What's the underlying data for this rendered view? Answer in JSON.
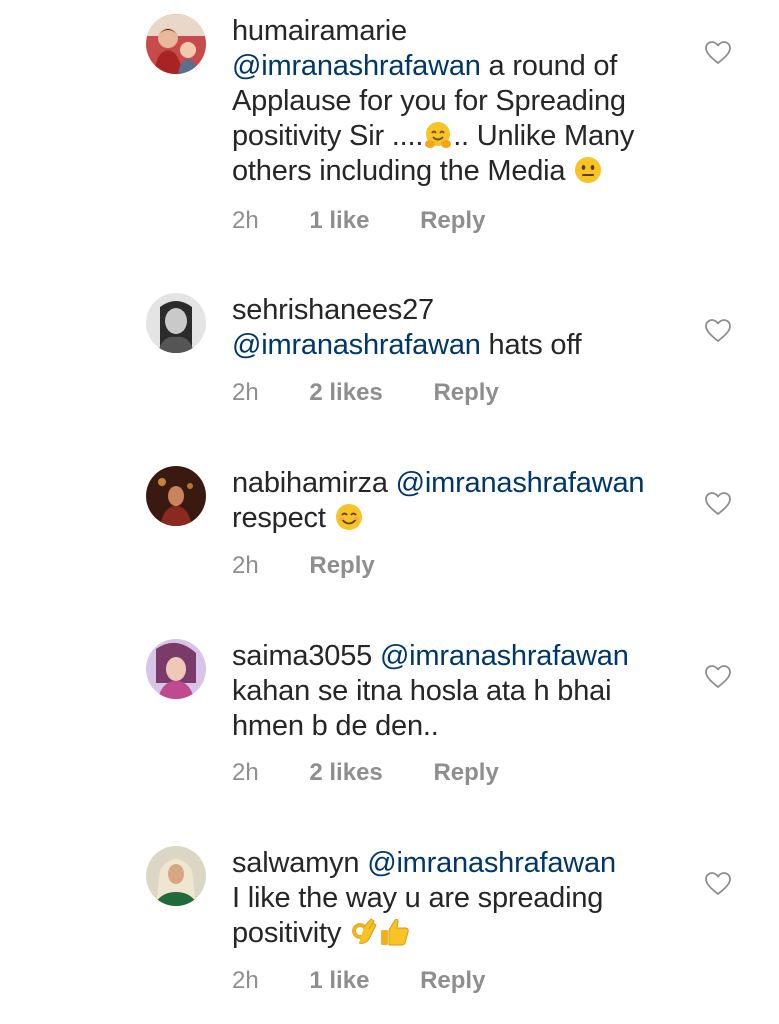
{
  "comments": [
    {
      "username": "humairamarie",
      "mention": "@imranashrafawan",
      "text_lines": [
        " a round of",
        "Applause for you  for Spreading",
        "positivity Sir ....",
        ".. Unlike Many",
        "others including the Media "
      ],
      "emojis": [
        "hugging-face",
        "neutral-face"
      ],
      "time": "2h",
      "likes": "1 like",
      "reply": "Reply",
      "avatar_color": "#b23a3a"
    },
    {
      "username": "sehrishanees27",
      "mention": "@imranashrafawan",
      "text": " hats off",
      "time": "2h",
      "likes": "2 likes",
      "reply": "Reply",
      "avatar_color": "#7a7a7a"
    },
    {
      "username": "nabihamirza",
      "mention": "@imranashrafawan",
      "text": "respect ",
      "emojis": [
        "smiling-face"
      ],
      "time": "2h",
      "reply": "Reply",
      "avatar_color": "#5a2a1a"
    },
    {
      "username": "saima3055",
      "mention": "@imranashrafawan",
      "text_lines": [
        "kahan se itna hosla ata h bhai",
        "hmen b de den.."
      ],
      "time": "2h",
      "likes": "2 likes",
      "reply": "Reply",
      "avatar_color": "#b55ca0"
    },
    {
      "username": "salwamyn",
      "mention": "@imranashrafawan",
      "text_lines": [
        "I like the way u are spreading",
        "positivity "
      ],
      "emojis": [
        "ok-hand",
        "thumbs-up"
      ],
      "time": "2h",
      "likes": "1 like",
      "reply": "Reply",
      "avatar_color": "#2f6e3a"
    }
  ],
  "icons": {
    "like": "heart-outline-icon"
  },
  "colors": {
    "mention": "#00376b",
    "meta": "#8e8e8e",
    "text": "#262626"
  }
}
